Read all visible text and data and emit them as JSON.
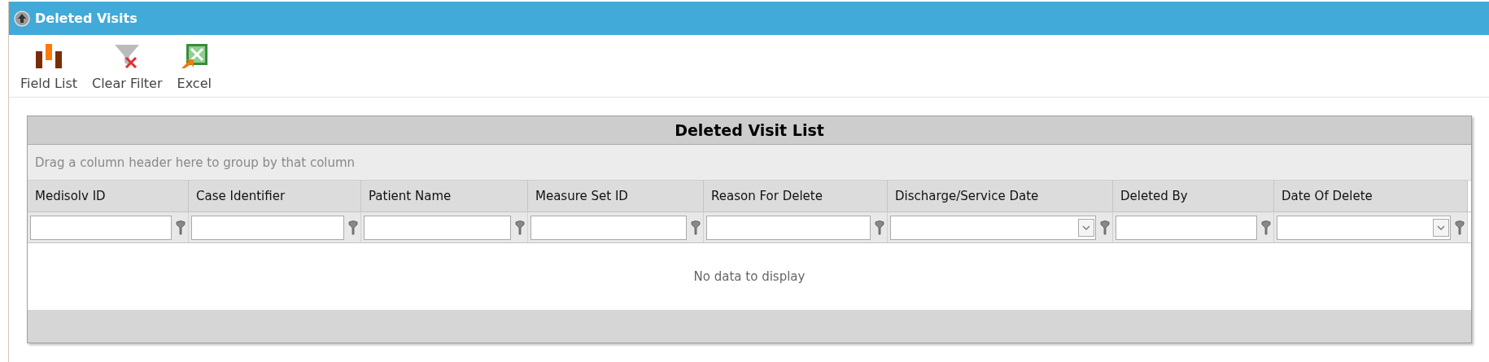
{
  "panel": {
    "title": "Deleted Visits",
    "expanded": true
  },
  "toolbar": [
    {
      "label": "Field List",
      "kind": "fields"
    },
    {
      "label": "Clear Filter",
      "kind": "clear"
    },
    {
      "label": "Excel",
      "kind": "excel"
    }
  ],
  "grid": {
    "title": "Deleted Visit List",
    "group_hint": "Drag a column header here to group by that column",
    "columns": [
      {
        "label": "Medisolv ID",
        "kind": "text"
      },
      {
        "label": "Case Identifier",
        "kind": "text"
      },
      {
        "label": "Patient Name",
        "kind": "text"
      },
      {
        "label": "Measure Set ID",
        "kind": "text"
      },
      {
        "label": "Reason For Delete",
        "kind": "text"
      },
      {
        "label": "Discharge/Service Date",
        "kind": "date"
      },
      {
        "label": "Deleted By",
        "kind": "text"
      },
      {
        "label": "Date Of Delete",
        "kind": "date"
      }
    ],
    "empty_text": "No data to display"
  }
}
